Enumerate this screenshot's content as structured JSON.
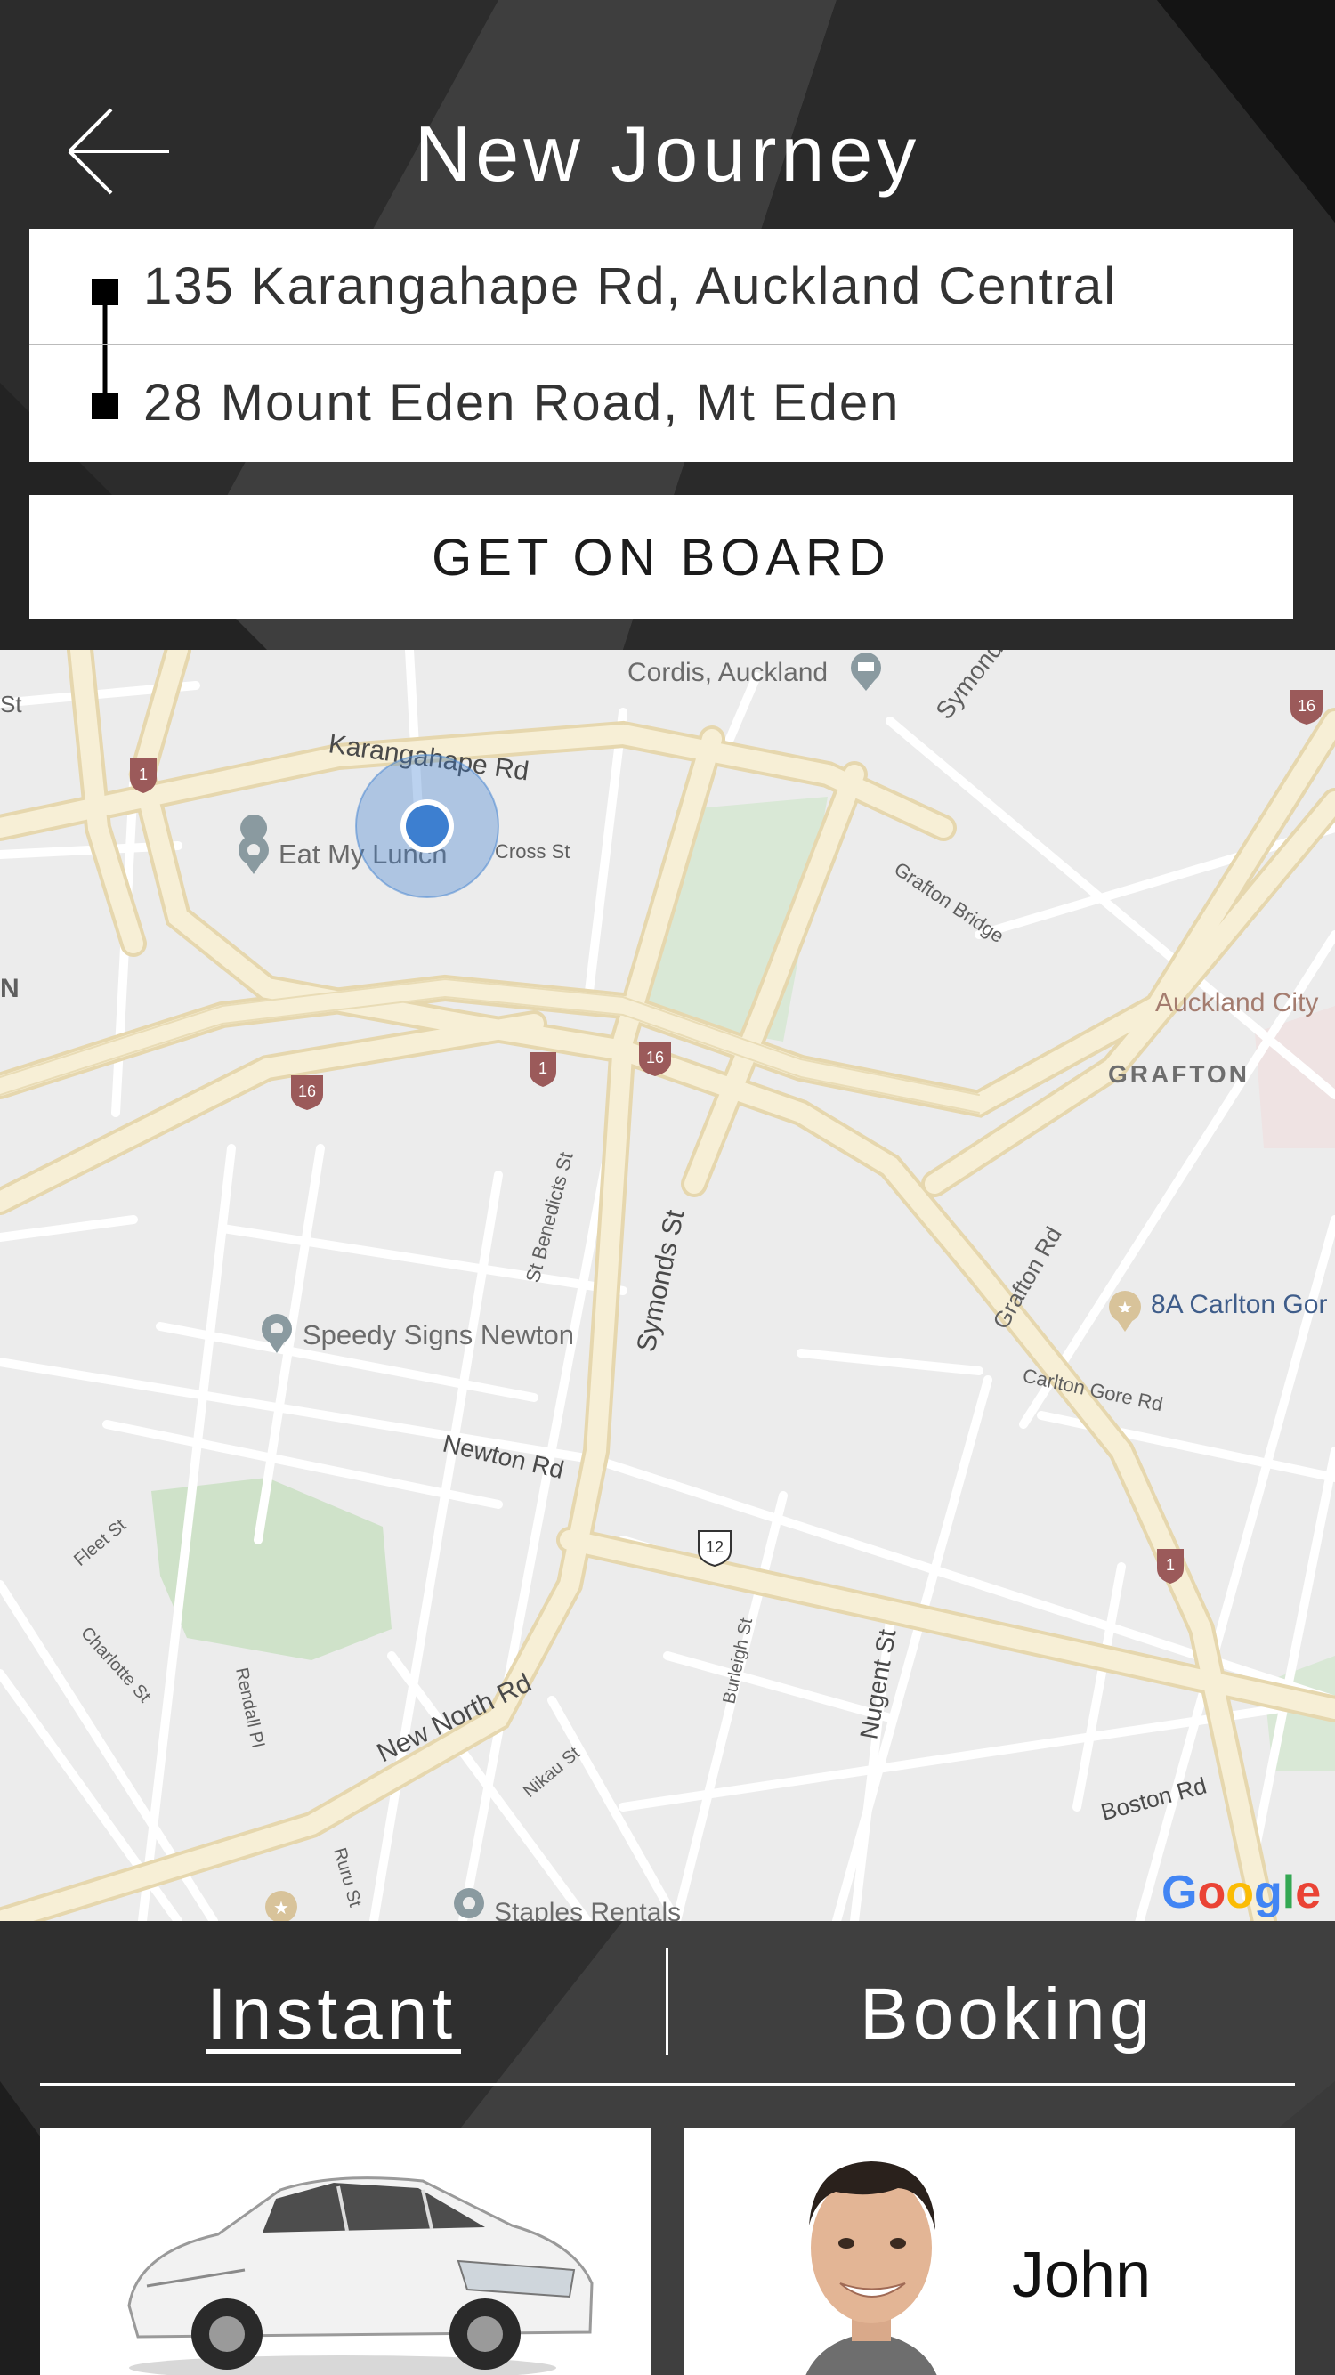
{
  "header": {
    "title": "New Journey",
    "back_icon": "arrow-left-icon"
  },
  "route": {
    "pickup": "135 Karangahape Rd, Auckland Central",
    "dropoff": "28 Mount Eden Road, Mt Eden"
  },
  "action": {
    "board_label": "GET ON BOARD"
  },
  "map": {
    "labels": {
      "cordis": "Cordis, Auckland",
      "symonds_top": "Symonds",
      "karangahape": "Karangahape Rd",
      "eat_my_lunch": "Eat My Lunch",
      "cross_st": "Cross St",
      "grafton_bridge": "Grafton Bridge",
      "auckland_city": "Auckland City",
      "grafton": "GRAFTON",
      "st_benedicts": "St Benedicts St",
      "symonds_st": "Symonds St",
      "grafton_rd": "Grafton Rd",
      "carlton_gore_place": "8A Carlton Gor",
      "carlton_gore_rd": "Carlton Gore Rd",
      "speedy_signs": "Speedy Signs Newton",
      "newton_rd": "Newton Rd",
      "fleet_st": "Fleet St",
      "charlotte_st": "Charlotte St",
      "rendall_pl": "Rendall Pl",
      "new_north_rd": "New North Rd",
      "nikau_st": "Nikau St",
      "burleigh_st": "Burleigh St",
      "nugent_st": "Nugent St",
      "boston_rd": "Boston Rd",
      "ruru_st": "Ruru St",
      "staples": "Staples Rentals",
      "st_edge": "St",
      "n_edge": "N"
    },
    "shields": {
      "r1": "1",
      "r16": "16",
      "r12": "12"
    },
    "attribution": [
      "G",
      "o",
      "o",
      "g",
      "l",
      "e"
    ]
  },
  "tabs": {
    "instant": "Instant",
    "booking": "Booking"
  },
  "driver": {
    "name": "John"
  },
  "colors": {
    "header_bg": "#1f1f1f",
    "map_bg": "#ececec",
    "road_major": "#f7efd6",
    "road_edge": "#e6d7ae",
    "location_dot": "#3d7fd0",
    "shield_red": "#9b5a5a",
    "google_blue": "#4285f4",
    "google_red": "#ea4335",
    "google_yellow": "#fbbc05",
    "google_green": "#34a853"
  }
}
